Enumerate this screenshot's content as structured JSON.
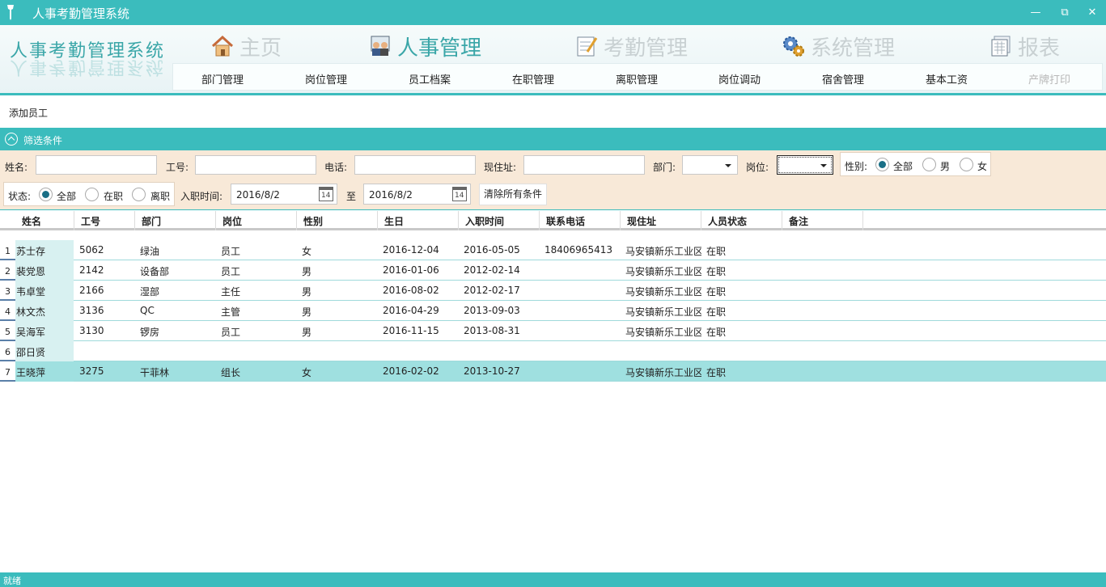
{
  "window": {
    "title": "人事考勤管理系统",
    "minimize": "—",
    "restore": "⧉",
    "close": "✕"
  },
  "brand": "人事考勤管理系统",
  "modules": [
    {
      "label": "主页",
      "icon": "house-icon",
      "active": false
    },
    {
      "label": "人事管理",
      "icon": "people-icon",
      "active": true
    },
    {
      "label": "考勤管理",
      "icon": "checklist-icon",
      "active": false
    },
    {
      "label": "系统管理",
      "icon": "gears-icon",
      "active": false
    },
    {
      "label": "报表",
      "icon": "report-icon",
      "active": false
    }
  ],
  "subnav": [
    {
      "label": "部门管理"
    },
    {
      "label": "岗位管理"
    },
    {
      "label": "员工档案"
    },
    {
      "label": "在职管理"
    },
    {
      "label": "离职管理"
    },
    {
      "label": "岗位调动"
    },
    {
      "label": "宿舍管理"
    },
    {
      "label": "基本工资"
    },
    {
      "label": "产牌打印",
      "disabled": true
    }
  ],
  "toolbar": {
    "add_employee": "添加员工"
  },
  "filter": {
    "title": "筛选条件",
    "name_label": "姓名:",
    "name_value": "",
    "id_label": "工号:",
    "id_value": "",
    "phone_label": "电话:",
    "phone_value": "",
    "address_label": "现住址:",
    "address_value": "",
    "dept_label": "部门:",
    "dept_value": "",
    "post_label": "岗位:",
    "post_value": "",
    "gender_label": "性别:",
    "gender_options": [
      "全部",
      "男",
      "女"
    ],
    "gender_selected": "全部",
    "status_label": "状态:",
    "status_options": [
      "全部",
      "在职",
      "离职"
    ],
    "status_selected": "全部",
    "hire_label": "入职时间:",
    "date_from": "2016/8/2",
    "to_label": "至",
    "date_to": "2016/8/2",
    "calendar_day": "14",
    "clear_button": "清除所有条件"
  },
  "table": {
    "columns": [
      "姓名",
      "工号",
      "部门",
      "岗位",
      "性别",
      "生日",
      "入职时间",
      "联系电话",
      "现住址",
      "人员状态",
      "备注"
    ],
    "rows": [
      {
        "num": "1",
        "name": "苏士存",
        "id": "5062",
        "dept": "绿油",
        "post": "员工",
        "gender": "女",
        "birthday": "2016-12-04",
        "hired": "2016-05-05",
        "phone": "18406965413",
        "address": "马安镇新乐工业区",
        "status": "在职",
        "note": ""
      },
      {
        "num": "2",
        "name": "裴党恩",
        "id": "2142",
        "dept": "设备部",
        "post": "员工",
        "gender": "男",
        "birthday": "2016-01-06",
        "hired": "2012-02-14",
        "phone": "",
        "address": "马安镇新乐工业区",
        "status": "在职",
        "note": ""
      },
      {
        "num": "3",
        "name": "韦卓堂",
        "id": "2166",
        "dept": "湿部",
        "post": "主任",
        "gender": "男",
        "birthday": "2016-08-02",
        "hired": "2012-02-17",
        "phone": "",
        "address": "马安镇新乐工业区",
        "status": "在职",
        "note": ""
      },
      {
        "num": "4",
        "name": "林文杰",
        "id": "3136",
        "dept": "QC",
        "post": "主管",
        "gender": "男",
        "birthday": "2016-04-29",
        "hired": "2013-09-03",
        "phone": "",
        "address": "马安镇新乐工业区",
        "status": "在职",
        "note": ""
      },
      {
        "num": "5",
        "name": "吴海军",
        "id": "3130",
        "dept": "锣房",
        "post": "员工",
        "gender": "男",
        "birthday": "2016-11-15",
        "hired": "2013-08-31",
        "phone": "",
        "address": "马安镇新乐工业区",
        "status": "在职",
        "note": ""
      },
      {
        "num": "6",
        "name": "邵日贤",
        "id": "",
        "dept": "",
        "post": "",
        "gender": "",
        "birthday": "",
        "hired": "",
        "phone": "",
        "address": "",
        "status": "",
        "note": ""
      },
      {
        "num": "7",
        "name": "王晓萍",
        "id": "3275",
        "dept": "干菲林",
        "post": "组长",
        "gender": "女",
        "birthday": "2016-02-02",
        "hired": "2013-10-27",
        "phone": "",
        "address": "马安镇新乐工业区",
        "status": "在职",
        "note": "",
        "selected": true
      }
    ]
  },
  "status": {
    "text": "就绪"
  }
}
